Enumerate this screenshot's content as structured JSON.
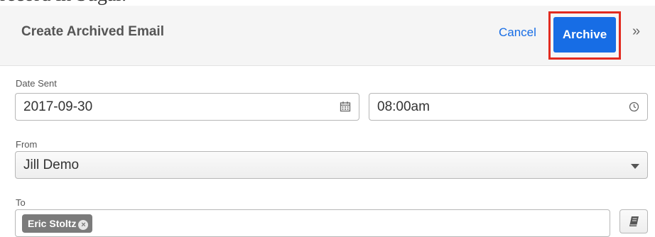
{
  "background_text": "record in Sugar.",
  "header": {
    "title": "Create Archived Email",
    "cancel_label": "Cancel",
    "archive_label": "Archive",
    "more_glyph": "»",
    "accent_color": "#176de5",
    "highlight_color": "#e22b20"
  },
  "form": {
    "date_sent": {
      "label": "Date Sent",
      "date_value": "2017-09-30",
      "date_icon": "calendar-icon",
      "time_value": "08:00am",
      "time_icon": "clock-icon"
    },
    "from": {
      "label": "From",
      "selected_value": "Jill Demo"
    },
    "to": {
      "label": "To",
      "recipients": [
        "Eric Stoltz"
      ],
      "address_book_icon": "address-book-icon"
    }
  }
}
